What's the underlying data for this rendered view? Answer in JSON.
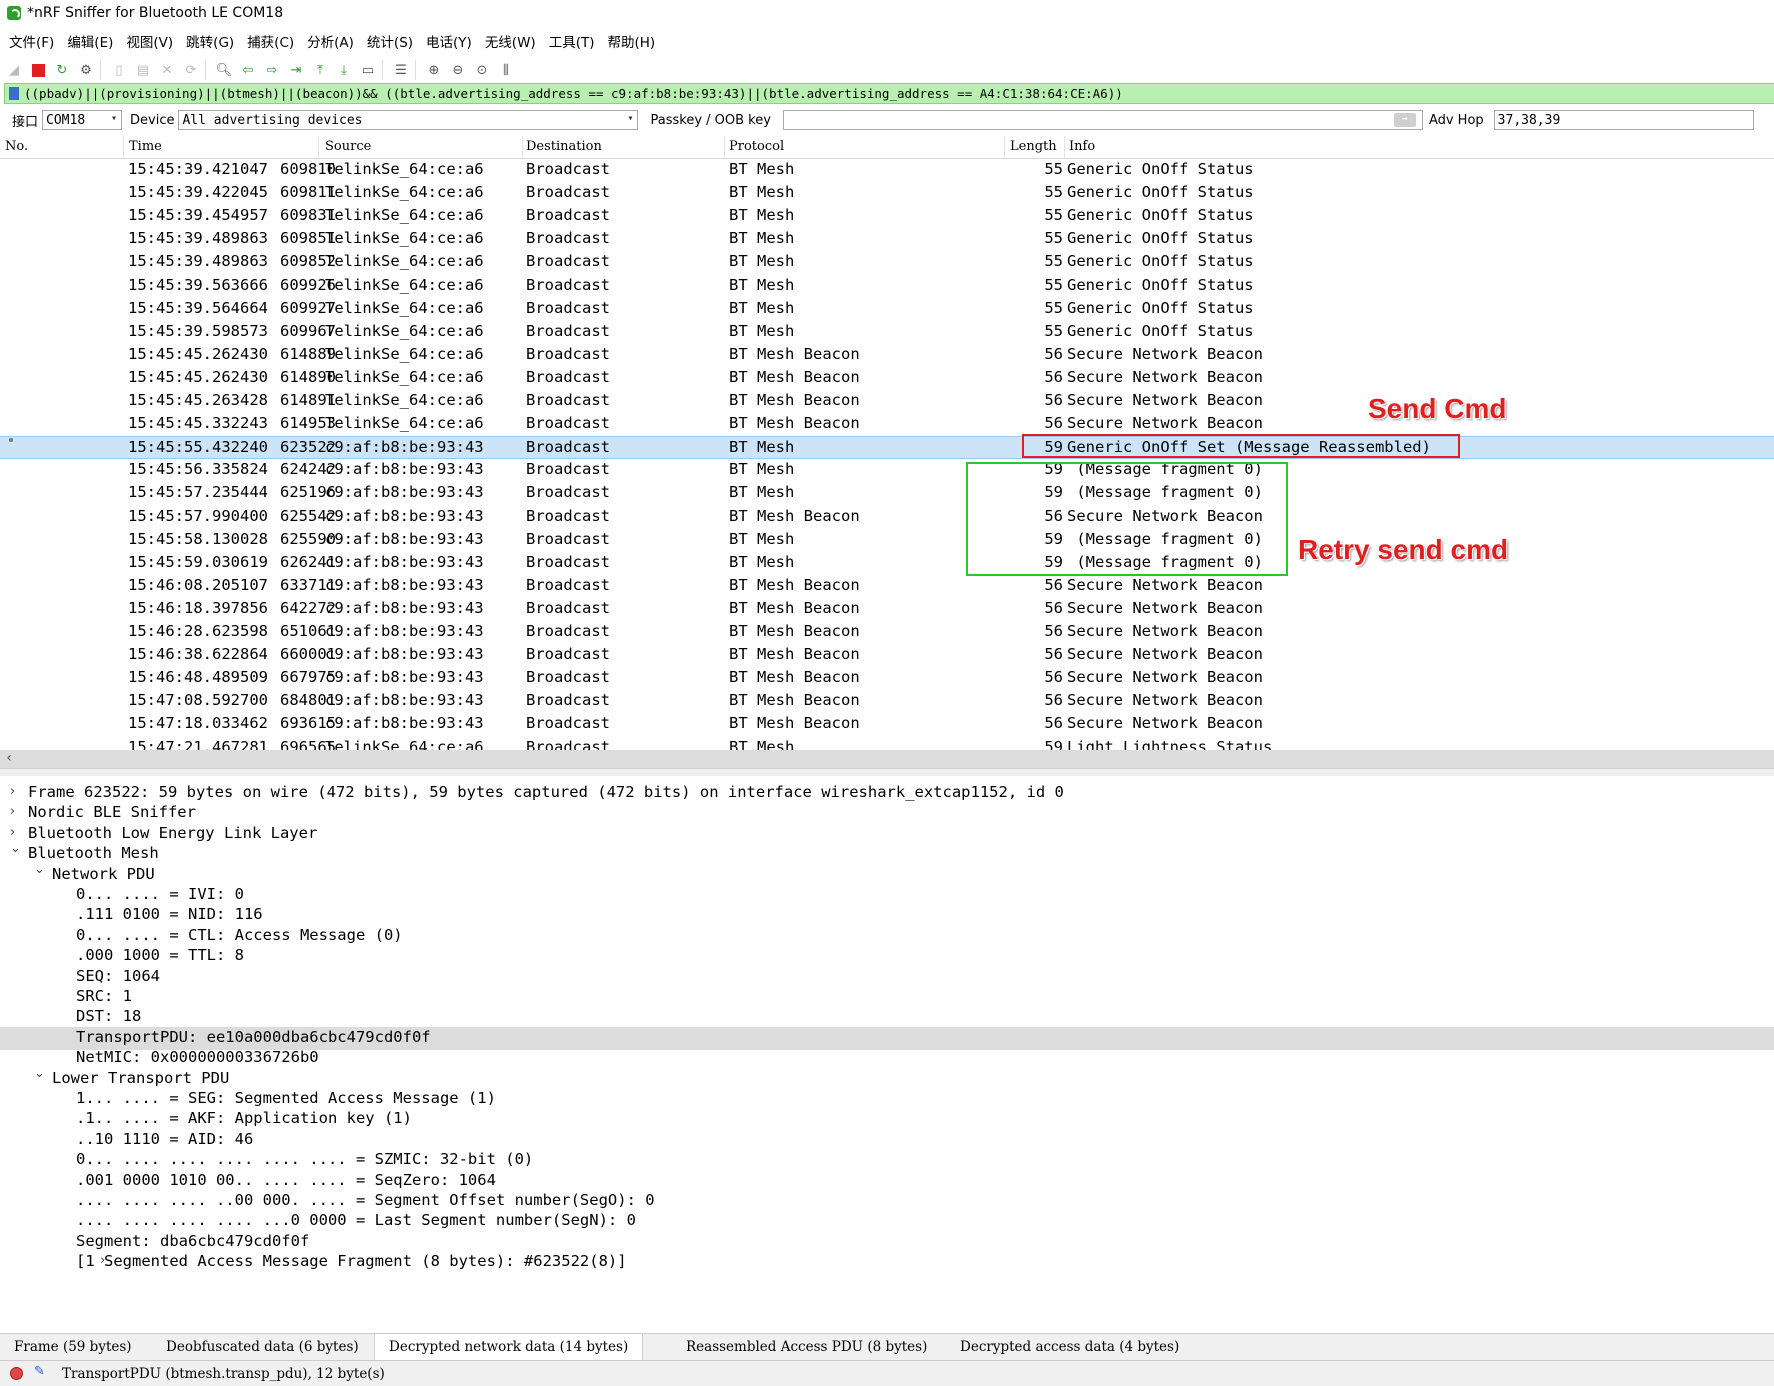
{
  "window": {
    "title": "*nRF Sniffer for Bluetooth LE COM18"
  },
  "menu": [
    "文件(F)",
    "编辑(E)",
    "视图(V)",
    "跳转(G)",
    "捕获(C)",
    "分析(A)",
    "统计(S)",
    "电话(Y)",
    "无线(W)",
    "工具(T)",
    "帮助(H)"
  ],
  "filter": {
    "text": "((pbadv)||(provisioning)||(btmesh)||(beacon))&& ((btle.advertising_address == c9:af:b8:be:93:43)||(btle.advertising_address == A4:C1:38:64:CE:A6))",
    "color": "#b8f0b0"
  },
  "interface_bar": {
    "interface_label": "接口",
    "interface_value": "COM18",
    "device_label": "Device",
    "device_value": "All advertising devices",
    "passkey_label": "Passkey / OOB key",
    "passkey_value": "",
    "adv_hop_label": "Adv Hop",
    "adv_hop_value": "37,38,39"
  },
  "columns": {
    "no": "No.",
    "time": "Time",
    "source": "Source",
    "destination": "Destination",
    "protocol": "Protocol",
    "length": "Length",
    "info": "Info"
  },
  "packets": [
    {
      "no": "609810",
      "time": "15:45:39.421047",
      "src": "TelinkSe_64:ce:a6",
      "dst": "Broadcast",
      "proto": "BT Mesh",
      "len": "55",
      "info": "Generic OnOff Status"
    },
    {
      "no": "609811",
      "time": "15:45:39.422045",
      "src": "TelinkSe_64:ce:a6",
      "dst": "Broadcast",
      "proto": "BT Mesh",
      "len": "55",
      "info": "Generic OnOff Status"
    },
    {
      "no": "609831",
      "time": "15:45:39.454957",
      "src": "TelinkSe_64:ce:a6",
      "dst": "Broadcast",
      "proto": "BT Mesh",
      "len": "55",
      "info": "Generic OnOff Status"
    },
    {
      "no": "609851",
      "time": "15:45:39.489863",
      "src": "TelinkSe_64:ce:a6",
      "dst": "Broadcast",
      "proto": "BT Mesh",
      "len": "55",
      "info": "Generic OnOff Status"
    },
    {
      "no": "609852",
      "time": "15:45:39.489863",
      "src": "TelinkSe_64:ce:a6",
      "dst": "Broadcast",
      "proto": "BT Mesh",
      "len": "55",
      "info": "Generic OnOff Status"
    },
    {
      "no": "609926",
      "time": "15:45:39.563666",
      "src": "TelinkSe_64:ce:a6",
      "dst": "Broadcast",
      "proto": "BT Mesh",
      "len": "55",
      "info": "Generic OnOff Status"
    },
    {
      "no": "609927",
      "time": "15:45:39.564664",
      "src": "TelinkSe_64:ce:a6",
      "dst": "Broadcast",
      "proto": "BT Mesh",
      "len": "55",
      "info": "Generic OnOff Status"
    },
    {
      "no": "609967",
      "time": "15:45:39.598573",
      "src": "TelinkSe_64:ce:a6",
      "dst": "Broadcast",
      "proto": "BT Mesh",
      "len": "55",
      "info": "Generic OnOff Status"
    },
    {
      "no": "614889",
      "time": "15:45:45.262430",
      "src": "TelinkSe_64:ce:a6",
      "dst": "Broadcast",
      "proto": "BT Mesh Beacon",
      "len": "56",
      "info": "Secure Network Beacon"
    },
    {
      "no": "614890",
      "time": "15:45:45.262430",
      "src": "TelinkSe_64:ce:a6",
      "dst": "Broadcast",
      "proto": "BT Mesh Beacon",
      "len": "56",
      "info": "Secure Network Beacon"
    },
    {
      "no": "614891",
      "time": "15:45:45.263428",
      "src": "TelinkSe_64:ce:a6",
      "dst": "Broadcast",
      "proto": "BT Mesh Beacon",
      "len": "56",
      "info": "Secure Network Beacon"
    },
    {
      "no": "614953",
      "time": "15:45:45.332243",
      "src": "TelinkSe_64:ce:a6",
      "dst": "Broadcast",
      "proto": "BT Mesh Beacon",
      "len": "56",
      "info": "Secure Network Beacon"
    },
    {
      "no": "623522",
      "time": "15:45:55.432240",
      "src": "c9:af:b8:be:93:43",
      "dst": "Broadcast",
      "proto": "BT Mesh",
      "len": "59",
      "info": "Generic OnOff Set (Message Reassembled)"
    },
    {
      "no": "624242",
      "time": "15:45:56.335824",
      "src": "c9:af:b8:be:93:43",
      "dst": "Broadcast",
      "proto": "BT Mesh",
      "len": "59",
      "info": " (Message fragment 0)"
    },
    {
      "no": "625196",
      "time": "15:45:57.235444",
      "src": "c9:af:b8:be:93:43",
      "dst": "Broadcast",
      "proto": "BT Mesh",
      "len": "59",
      "info": " (Message fragment 0)"
    },
    {
      "no": "625542",
      "time": "15:45:57.990400",
      "src": "c9:af:b8:be:93:43",
      "dst": "Broadcast",
      "proto": "BT Mesh Beacon",
      "len": "56",
      "info": "Secure Network Beacon"
    },
    {
      "no": "625590",
      "time": "15:45:58.130028",
      "src": "c9:af:b8:be:93:43",
      "dst": "Broadcast",
      "proto": "BT Mesh",
      "len": "59",
      "info": " (Message fragment 0)"
    },
    {
      "no": "626241",
      "time": "15:45:59.030619",
      "src": "c9:af:b8:be:93:43",
      "dst": "Broadcast",
      "proto": "BT Mesh",
      "len": "59",
      "info": " (Message fragment 0)"
    },
    {
      "no": "633711",
      "time": "15:46:08.205107",
      "src": "c9:af:b8:be:93:43",
      "dst": "Broadcast",
      "proto": "BT Mesh Beacon",
      "len": "56",
      "info": "Secure Network Beacon"
    },
    {
      "no": "642272",
      "time": "15:46:18.397856",
      "src": "c9:af:b8:be:93:43",
      "dst": "Broadcast",
      "proto": "BT Mesh Beacon",
      "len": "56",
      "info": "Secure Network Beacon"
    },
    {
      "no": "651061",
      "time": "15:46:28.623598",
      "src": "c9:af:b8:be:93:43",
      "dst": "Broadcast",
      "proto": "BT Mesh Beacon",
      "len": "56",
      "info": "Secure Network Beacon"
    },
    {
      "no": "660001",
      "time": "15:46:38.622864",
      "src": "c9:af:b8:be:93:43",
      "dst": "Broadcast",
      "proto": "BT Mesh Beacon",
      "len": "56",
      "info": "Secure Network Beacon"
    },
    {
      "no": "667975",
      "time": "15:46:48.489509",
      "src": "c9:af:b8:be:93:43",
      "dst": "Broadcast",
      "proto": "BT Mesh Beacon",
      "len": "56",
      "info": "Secure Network Beacon"
    },
    {
      "no": "684801",
      "time": "15:47:08.592700",
      "src": "c9:af:b8:be:93:43",
      "dst": "Broadcast",
      "proto": "BT Mesh Beacon",
      "len": "56",
      "info": "Secure Network Beacon"
    },
    {
      "no": "693615",
      "time": "15:47:18.033462",
      "src": "c9:af:b8:be:93:43",
      "dst": "Broadcast",
      "proto": "BT Mesh Beacon",
      "len": "56",
      "info": "Secure Network Beacon"
    },
    {
      "no": "696565",
      "time": "15:47:21.467281",
      "src": "TelinkSe_64:ce:a6",
      "dst": "Broadcast",
      "proto": "BT Mesh",
      "len": "59",
      "info": "Light Lightness Status"
    }
  ],
  "selected_packet": "623522",
  "details": [
    {
      "level": 0,
      "arrow": "right",
      "text": "Frame 623522: 59 bytes on wire (472 bits), 59 bytes captured (472 bits) on interface wireshark_extcap1152, id 0"
    },
    {
      "level": 0,
      "arrow": "right",
      "text": "Nordic BLE Sniffer"
    },
    {
      "level": 0,
      "arrow": "right",
      "text": "Bluetooth Low Energy Link Layer"
    },
    {
      "level": 0,
      "arrow": "down",
      "text": "Bluetooth Mesh"
    },
    {
      "level": 1,
      "arrow": "down",
      "text": "Network PDU"
    },
    {
      "level": 2,
      "arrow": "",
      "text": "0... .... = IVI: 0"
    },
    {
      "level": 2,
      "arrow": "",
      "text": ".111 0100 = NID: 116"
    },
    {
      "level": 2,
      "arrow": "",
      "text": "0... .... = CTL: Access Message (0)"
    },
    {
      "level": 2,
      "arrow": "",
      "text": ".000 1000 = TTL: 8"
    },
    {
      "level": 2,
      "arrow": "",
      "text": "SEQ: 1064"
    },
    {
      "level": 2,
      "arrow": "",
      "text": "SRC: 1"
    },
    {
      "level": 2,
      "arrow": "",
      "text": "DST: 18"
    },
    {
      "level": 2,
      "arrow": "",
      "text": "TransportPDU: ee10a000dba6cbc479cd0f0f",
      "highlight": true
    },
    {
      "level": 2,
      "arrow": "",
      "text": "NetMIC: 0x00000000336726b0"
    },
    {
      "level": 1,
      "arrow": "down",
      "text": "Lower Transport PDU"
    },
    {
      "level": 2,
      "arrow": "",
      "text": "1... .... = SEG: Segmented Access Message (1)"
    },
    {
      "level": 2,
      "arrow": "",
      "text": ".1.. .... = AKF: Application key (1)"
    },
    {
      "level": 2,
      "arrow": "",
      "text": "..10 1110 = AID: 46"
    },
    {
      "level": 2,
      "arrow": "",
      "text": "0... .... .... .... .... .... = SZMIC: 32-bit (0)"
    },
    {
      "level": 2,
      "arrow": "",
      "text": ".001 0000 1010 00.. .... .... = SeqZero: 1064"
    },
    {
      "level": 2,
      "arrow": "",
      "text": ".... .... .... ..00 000. .... = Segment Offset number(SegO): 0"
    },
    {
      "level": 2,
      "arrow": "",
      "text": ".... .... .... .... ...0 0000 = Last Segment number(SegN): 0"
    },
    {
      "level": 2,
      "arrow": "",
      "text": "Segment: dba6cbc479cd0f0f"
    },
    {
      "level": 2,
      "arrow": "right",
      "text": "[1 Segmented Access Message Fragment (8 bytes): #623522(8)]"
    }
  ],
  "bytes_tabs": [
    {
      "label": "Frame (59 bytes)",
      "active": false
    },
    {
      "label": "Deobfuscated data (6 bytes)",
      "active": false
    },
    {
      "label": "Decrypted network data (14 bytes)",
      "active": true
    },
    {
      "label": "Reassembled Access PDU (8 bytes)",
      "active": false
    },
    {
      "label": "Decrypted access data (4 bytes)",
      "active": false
    }
  ],
  "status": {
    "text": "TransportPDU (btmesh.transp_pdu), 12 byte(s)"
  },
  "annotations": {
    "send_cmd": "Send Cmd",
    "retry": "Retry send cmd",
    "red": "#e02020",
    "green": "#27c827"
  },
  "colors": {
    "selected_row": "#cce4f7",
    "filter_ok": "#b8f0b0"
  }
}
